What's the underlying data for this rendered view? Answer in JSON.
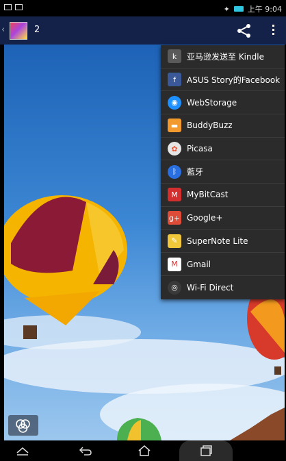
{
  "status_bar": {
    "time": "上午 9:04"
  },
  "action_bar": {
    "photo_count": "2"
  },
  "share_menu": {
    "items": [
      {
        "label": "亚马逊发送至 Kindle",
        "icon": "kindle-icon",
        "color": "#5a5a5a"
      },
      {
        "label": "ASUS Story的Facebook",
        "icon": "facebook-icon",
        "color": "#3b5998"
      },
      {
        "label": "WebStorage",
        "icon": "webstorage-icon",
        "color": "#1e90ff"
      },
      {
        "label": "BuddyBuzz",
        "icon": "buddybuzz-icon",
        "color": "#f29a2e"
      },
      {
        "label": "Picasa",
        "icon": "picasa-icon",
        "color": "#e5e5e5"
      },
      {
        "label": "藍牙",
        "icon": "bluetooth-icon",
        "color": "#2a6fe0"
      },
      {
        "label": "MyBitCast",
        "icon": "mybitcast-icon",
        "color": "#d32f2f"
      },
      {
        "label": "Google+",
        "icon": "google-plus-icon",
        "color": "#dd4b39"
      },
      {
        "label": "SuperNote Lite",
        "icon": "supernote-icon",
        "color": "#f0c63a"
      },
      {
        "label": "Gmail",
        "icon": "gmail-icon",
        "color": "#ffffff"
      },
      {
        "label": "Wi-Fi Direct",
        "icon": "wifi-direct-icon",
        "color": "#3a3a3a"
      }
    ]
  },
  "colors": {
    "action_bar": "#14224a",
    "menu_bg": "#2b2b2b",
    "sky_top": "#1d62b6",
    "sky_bottom": "#9cc7ee"
  }
}
